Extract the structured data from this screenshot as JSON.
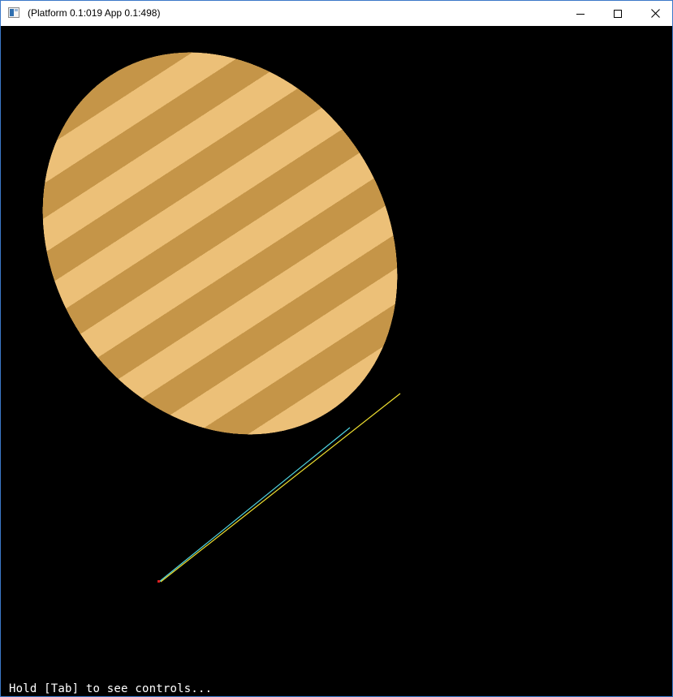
{
  "window": {
    "title": "(Platform 0.1:019 App 0.1:498)",
    "icon": "app-window-icon",
    "controls": {
      "minimize_icon": "minimize-icon",
      "maximize_icon": "maximize-icon",
      "close_icon": "close-icon"
    }
  },
  "scene": {
    "background_color": "#000000",
    "balloon": {
      "light_color": "#ecc078",
      "dark_color": "#c59548",
      "rim_color": "#dcaa5c"
    },
    "tether": {
      "line_colors": [
        "#4fd3e0",
        "#f0e030"
      ],
      "anchor_color": "#e02020"
    }
  },
  "hint": {
    "text": "Hold [Tab] to see controls..."
  }
}
